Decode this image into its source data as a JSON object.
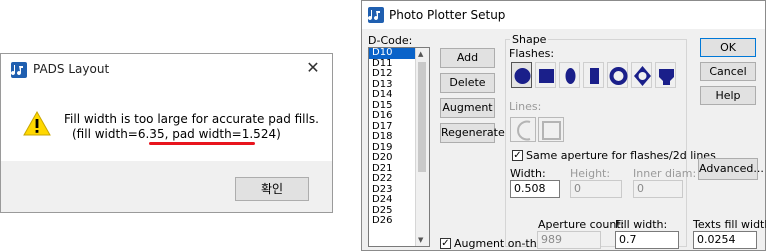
{
  "pads_dialog": {
    "title": "PADS Layout",
    "close_glyph": "✕",
    "message_line1": "Fill width is too large for accurate pad fills.",
    "message_line2": "(fill width=6.35, pad width=1.524)",
    "ok_label": "확인",
    "icon": "warning-icon",
    "underline_color": "#e8141d"
  },
  "plotter_dialog": {
    "title": "Photo Plotter Setup",
    "dcode_label": "D-Code:",
    "dcodes": [
      "D10",
      "D11",
      "D12",
      "D13",
      "D14",
      "D15",
      "D16",
      "D17",
      "D18",
      "D19",
      "D20",
      "D21",
      "D22",
      "D23",
      "D24",
      "D25",
      "D26"
    ],
    "selected_dcode": "D10",
    "buttons": {
      "add": "Add",
      "delete": "Delete",
      "augment": "Augment",
      "regenerate": "Regenerate",
      "ok": "OK",
      "cancel": "Cancel",
      "help": "Help",
      "advanced": "Advanced..."
    },
    "shape": {
      "legend": "Shape",
      "flashes_label": "Flashes:",
      "flash_shapes": [
        "round-icon",
        "square-icon",
        "oval-icon",
        "rectangle-icon",
        "annular-icon",
        "thermal-icon",
        "target-icon"
      ],
      "lines_label": "Lines:",
      "same_aperture_label": "Same aperture for flashes/2d lines",
      "same_aperture_checked": true,
      "width_label": "Width:",
      "width_value": "0.508",
      "height_label": "Height:",
      "height_value": "0",
      "inner_diam_label": "Inner diam:",
      "inner_diam_value": "0"
    },
    "augment_on_fly_label": "Augment on-the-fly",
    "augment_on_fly_checked": true,
    "aperture_count_label": "Aperture count:",
    "aperture_count_value": "989",
    "fill_width_label": "Fill width:",
    "fill_width_value": "0.7",
    "texts_fill_width_label": "Texts fill width:",
    "texts_fill_width_value": "0.0254",
    "accent_color": "#0a63c9",
    "highlight_color": "#e8141d"
  }
}
